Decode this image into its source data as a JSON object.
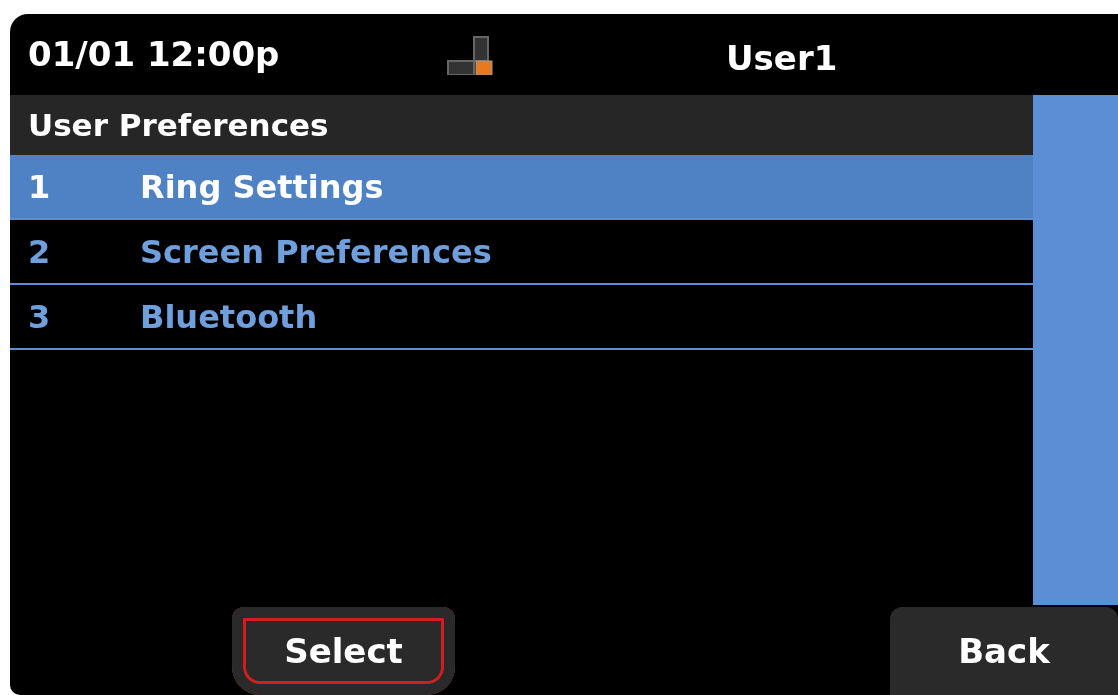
{
  "status_bar": {
    "datetime": "01/01 12:00p",
    "user": "User1"
  },
  "menu": {
    "title": "User Preferences",
    "items": [
      {
        "number": "1",
        "label": "Ring Settings",
        "selected": true
      },
      {
        "number": "2",
        "label": "Screen Preferences",
        "selected": false
      },
      {
        "number": "3",
        "label": "Bluetooth",
        "selected": false
      }
    ]
  },
  "softkeys": [
    {
      "label": "Select",
      "focused": true
    },
    {
      "label": "Back",
      "focused": false
    }
  ]
}
